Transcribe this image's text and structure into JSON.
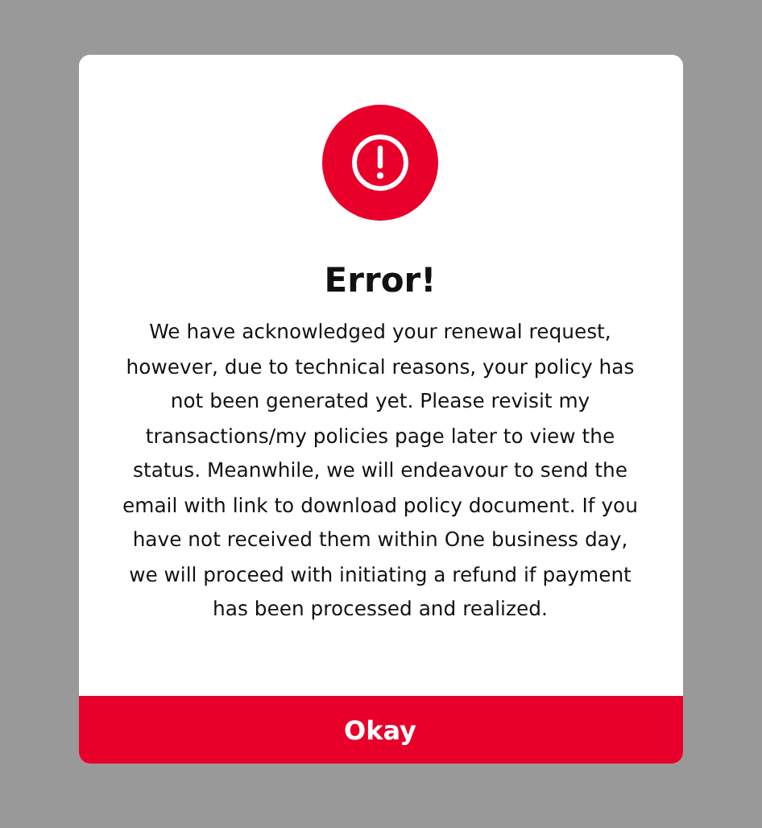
{
  "dialog": {
    "title": "Error!",
    "message": "We have acknowledged your renewal request, however, due to technical reasons, your policy has not been generated yet. Please revisit my transactions/my policies page later to view the status. Meanwhile, we will endeavour to send the email with link to download policy document. If you have not received them within One business day, we will proceed with initiating a refund if payment has been processed and realized.",
    "button": "Okay"
  }
}
